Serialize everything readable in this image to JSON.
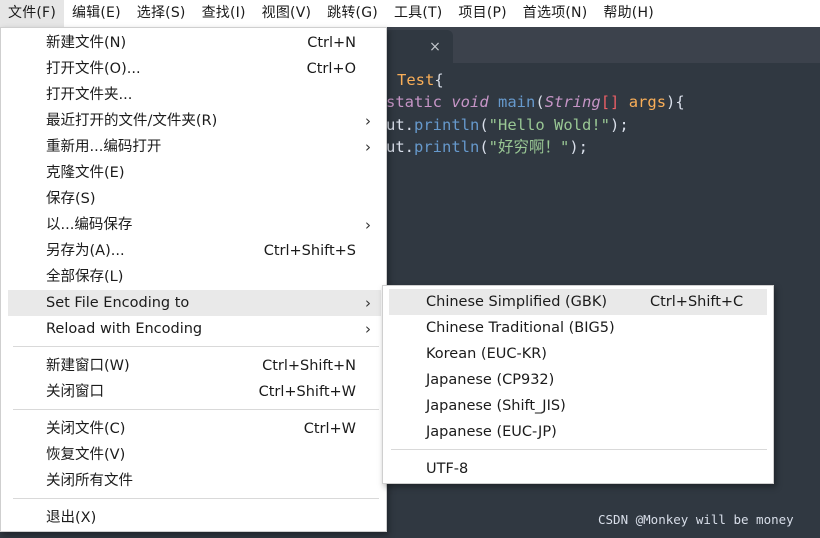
{
  "menubar": {
    "items": [
      "文件(F)",
      "编辑(E)",
      "选择(S)",
      "查找(I)",
      "视图(V)",
      "跳转(G)",
      "工具(T)",
      "项目(P)",
      "首选项(N)",
      "帮助(H)"
    ]
  },
  "tab": {
    "close_glyph": "×"
  },
  "editor": {
    "line1": {
      "cls": "Test",
      "brace": "{"
    },
    "line2": {
      "static": "static",
      "void": "void",
      "main": "main",
      "paren": "(",
      "type": "String",
      "brackets": "[]",
      "arg": "args",
      "close": "){"
    },
    "line3": {
      "prefix": "ut.",
      "fn": "println",
      "open": "(",
      "str": "\"Hello Wold!\"",
      "close": ");"
    },
    "line4": {
      "prefix": "ut.",
      "fn": "println",
      "open": "(",
      "str": "\"好穷啊！\"",
      "close": ");"
    }
  },
  "file_menu": {
    "items": [
      {
        "label": "新建文件(N)",
        "shortcut": "Ctrl+N"
      },
      {
        "label": "打开文件(O)...",
        "shortcut": "Ctrl+O"
      },
      {
        "label": "打开文件夹...",
        "shortcut": ""
      },
      {
        "label": "最近打开的文件/文件夹(R)",
        "shortcut": "",
        "submenu": "›"
      },
      {
        "label": "重新用...编码打开",
        "shortcut": "",
        "submenu": "›"
      },
      {
        "label": "克隆文件(E)",
        "shortcut": ""
      },
      {
        "label": "保存(S)",
        "shortcut": ""
      },
      {
        "label": "以...编码保存",
        "shortcut": "",
        "submenu": "›"
      },
      {
        "label": "另存为(A)...",
        "shortcut": "Ctrl+Shift+S"
      },
      {
        "label": "全部保存(L)",
        "shortcut": ""
      },
      {
        "label": "Set File Encoding to",
        "shortcut": "",
        "submenu": "›"
      },
      {
        "label": "Reload with Encoding",
        "shortcut": "",
        "submenu": "›"
      },
      {
        "label": "新建窗口(W)",
        "shortcut": "Ctrl+Shift+N"
      },
      {
        "label": "关闭窗口",
        "shortcut": "Ctrl+Shift+W"
      },
      {
        "label": "关闭文件(C)",
        "shortcut": "Ctrl+W"
      },
      {
        "label": "恢复文件(V)",
        "shortcut": ""
      },
      {
        "label": "关闭所有文件",
        "shortcut": ""
      },
      {
        "label": "退出(X)",
        "shortcut": ""
      }
    ]
  },
  "encoding_submenu": {
    "items": [
      {
        "label": "Chinese Simplified (GBK)",
        "shortcut": "Ctrl+Shift+C"
      },
      {
        "label": "Chinese Traditional (BIG5)",
        "shortcut": ""
      },
      {
        "label": "Korean (EUC-KR)",
        "shortcut": ""
      },
      {
        "label": "Japanese (CP932)",
        "shortcut": ""
      },
      {
        "label": "Japanese (Shift_JIS)",
        "shortcut": ""
      },
      {
        "label": "Japanese (EUC-JP)",
        "shortcut": ""
      },
      {
        "label": "UTF-8",
        "shortcut": ""
      }
    ]
  },
  "watermark": "CSDN @Monkey will be money",
  "colors": {
    "editor_bg": "#303841",
    "highlight": "#e9e9e9",
    "keyword": "#c695c6",
    "string": "#99c794",
    "function": "#6699cc",
    "type": "#f9ae58"
  }
}
